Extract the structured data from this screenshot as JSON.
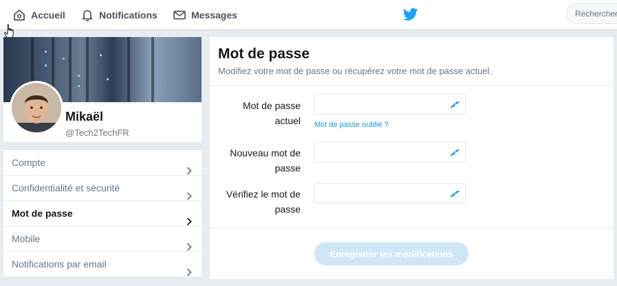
{
  "nav": {
    "home_label": "Accueil",
    "notifications_label": "Notifications",
    "messages_label": "Messages",
    "search_placeholder": "Rechercher"
  },
  "profile": {
    "name": "Mikaël",
    "handle": "@Tech2TechFR"
  },
  "menu": {
    "items": [
      {
        "label": "Compte",
        "active": false
      },
      {
        "label": "Confidentialité et sécurité",
        "active": false
      },
      {
        "label": "Mot de passe",
        "active": true
      },
      {
        "label": "Mobile",
        "active": false
      },
      {
        "label": "Notifications par email",
        "active": false
      }
    ]
  },
  "panel": {
    "title": "Mot de passe",
    "subtitle": "Modifiez votre mot de passe ou récupérez votre mot de passe actuel.",
    "fields": [
      {
        "label_line1": "Mot de passe",
        "label_line2": "actuel",
        "value": ""
      },
      {
        "label_line1": "Nouveau mot de",
        "label_line2": "passe",
        "value": ""
      },
      {
        "label_line1": "Vérifiez le mot de",
        "label_line2": "passe",
        "value": ""
      }
    ],
    "forgot_link": "Mot de passe oublié ?",
    "save_label": "Enregistrer les modifications"
  },
  "colors": {
    "accent": "#1da1f2",
    "link": "#1b95e0",
    "save_disabled": "#cfe6f7",
    "background": "#e6ecf0"
  },
  "icons": [
    "home-icon",
    "bell-icon",
    "envelope-icon",
    "twitter-bird-icon",
    "chevron-right-icon",
    "key-icon",
    "hand-cursor-icon"
  ]
}
